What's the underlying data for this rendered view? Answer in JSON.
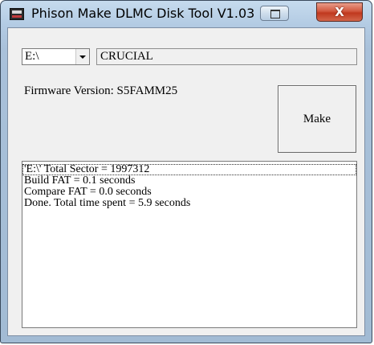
{
  "window": {
    "title": "Phison Make DLMC Disk Tool V1.03",
    "close_label": "X"
  },
  "drive": {
    "selected": "E:\\"
  },
  "volume_label": "CRUCIAL",
  "firmware": {
    "label": "Firmware Version: S5FAMM25"
  },
  "make_button": {
    "label": "Make"
  },
  "log": {
    "lines": [
      "'E:\\' Total Sector = 1997312",
      "Build FAT = 0.1 seconds",
      "Compare FAT = 0.0 seconds",
      "Done. Total time spent = 5.9 seconds"
    ]
  },
  "colors": {
    "title_bar": "#b3cbe3",
    "close_button": "#c7462b",
    "client_background": "#f0f0f0"
  },
  "icons": [
    "app-icon",
    "restore-icon",
    "close-icon",
    "dropdown-arrow-icon"
  ]
}
